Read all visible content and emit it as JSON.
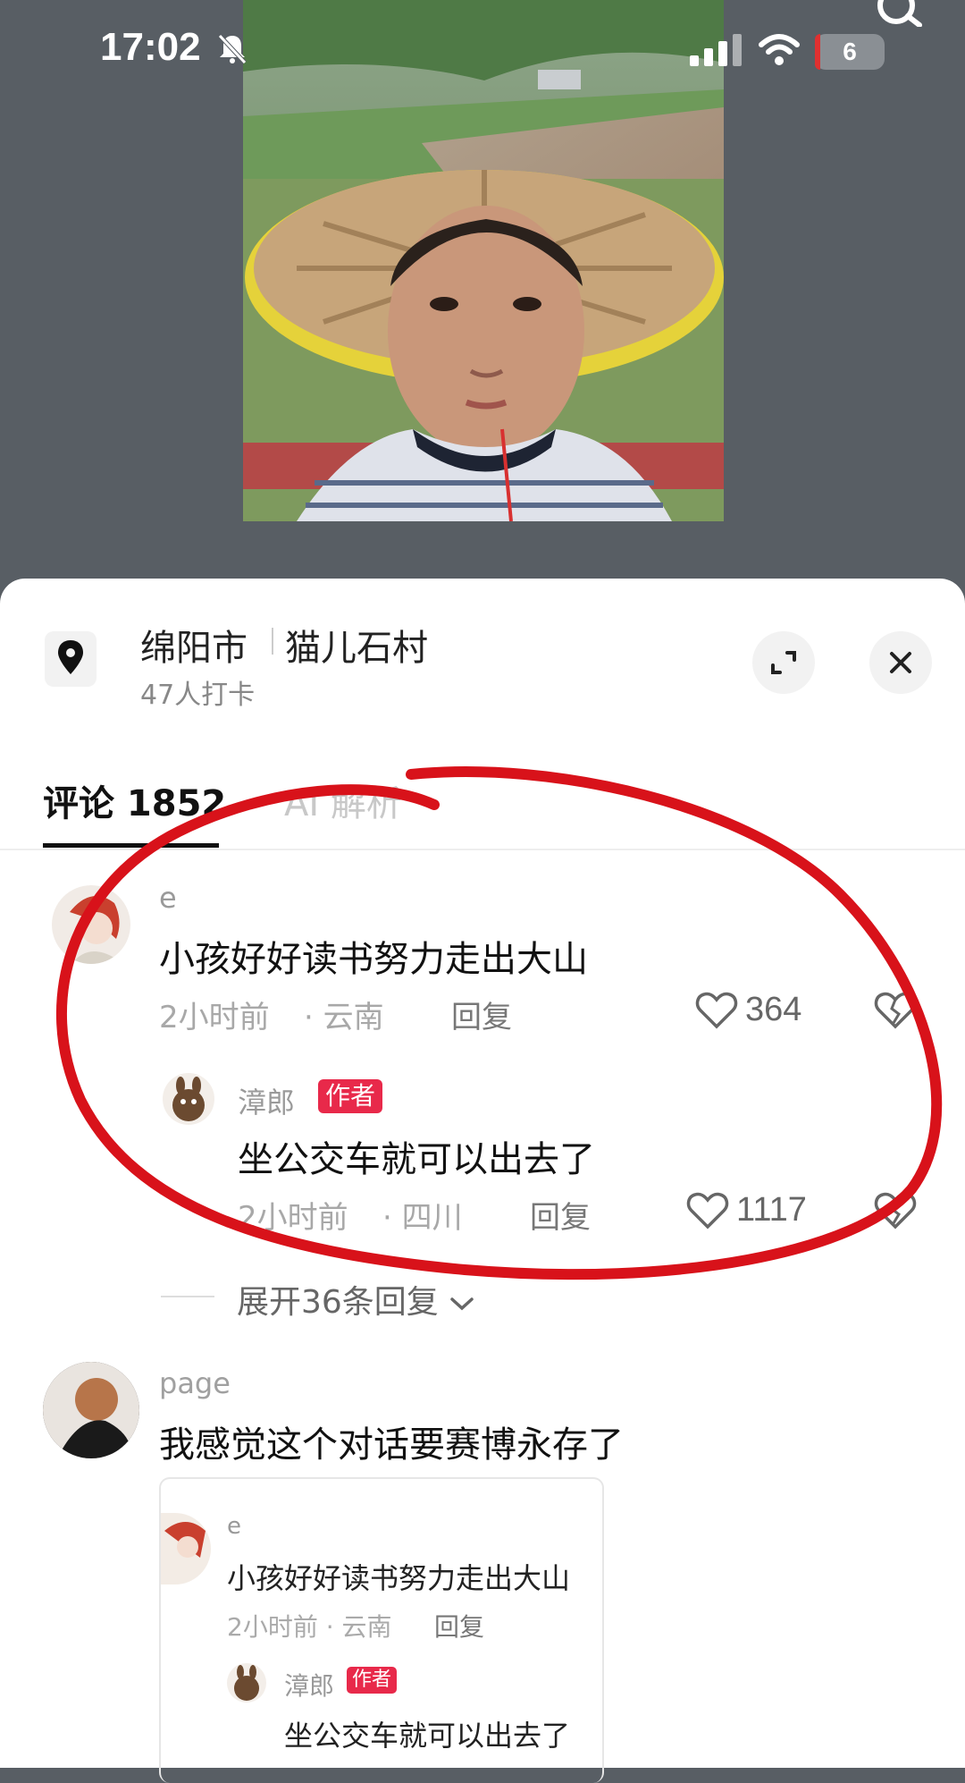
{
  "status_bar": {
    "time": "17:02",
    "battery": "6"
  },
  "location": {
    "city": "绵阳市",
    "village": "猫儿石村",
    "checkins": "47人打卡"
  },
  "tabs": {
    "comments": "评论 1852",
    "ai": "AI 解析"
  },
  "comments": [
    {
      "user": "e",
      "text": "小孩好好读书努力走出大山",
      "time": "2小时前",
      "region": "· 云南",
      "reply": "回复",
      "likes": "364",
      "replies": [
        {
          "user": "漳郎",
          "badge": "作者",
          "text": "坐公交车就可以出去了",
          "time": "2小时前",
          "region": "· 四川",
          "reply": "回复",
          "likes": "1117"
        }
      ],
      "expand": "展开36条回复"
    },
    {
      "user": "page",
      "text": "我感觉这个对话要赛博永存了",
      "quote": {
        "user": "e",
        "text": "小孩好好读书努力走出大山",
        "meta": "2小时前 · 云南",
        "reply": "回复",
        "reply_user": "漳郎",
        "reply_badge": "作者",
        "reply_text": "坐公交车就可以出去了"
      }
    }
  ],
  "colors": {
    "accent_red": "#e8294a",
    "annotation_red": "#d8121a"
  }
}
